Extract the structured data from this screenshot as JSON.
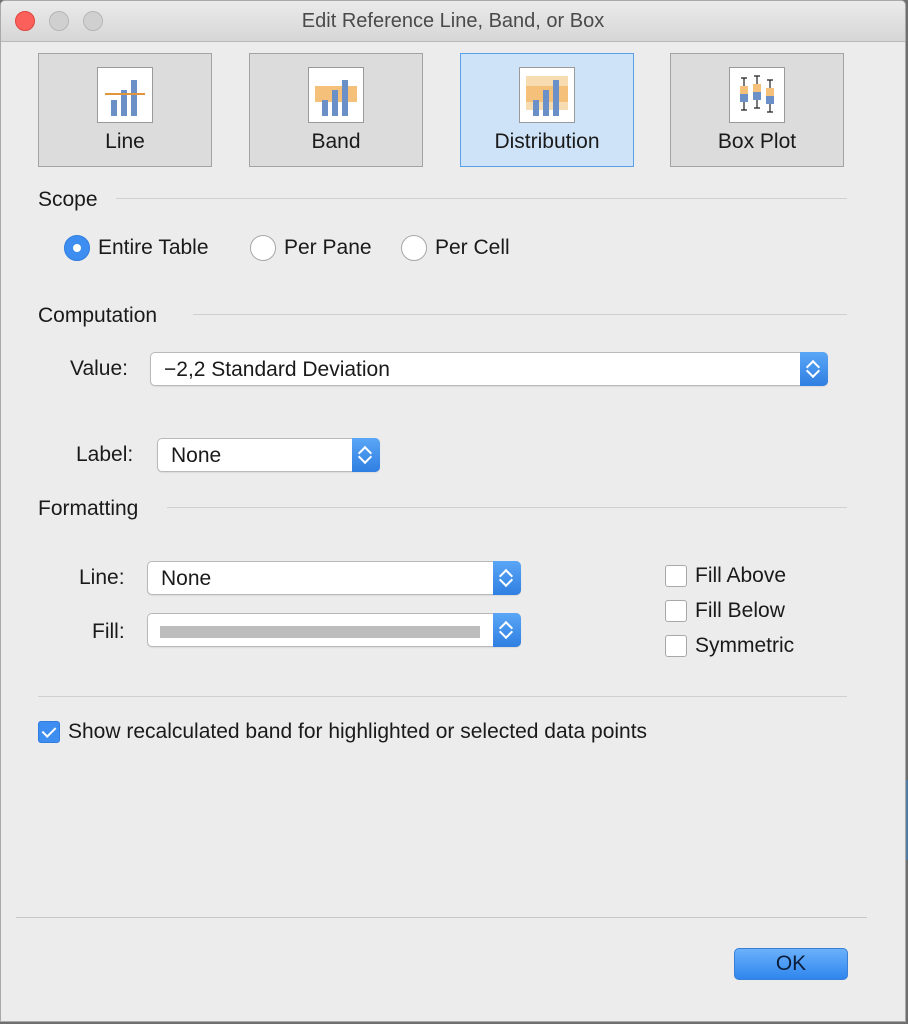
{
  "window": {
    "title": "Edit Reference Line, Band, or Box"
  },
  "tabs": [
    {
      "label": "Line",
      "icon": "reference-line-icon",
      "selected": false
    },
    {
      "label": "Band",
      "icon": "reference-band-icon",
      "selected": false
    },
    {
      "label": "Distribution",
      "icon": "distribution-icon",
      "selected": true
    },
    {
      "label": "Box Plot",
      "icon": "box-plot-icon",
      "selected": false
    }
  ],
  "scope": {
    "heading": "Scope",
    "options": [
      {
        "label": "Entire Table",
        "selected": true
      },
      {
        "label": "Per Pane",
        "selected": false
      },
      {
        "label": "Per Cell",
        "selected": false
      }
    ]
  },
  "computation": {
    "heading": "Computation",
    "value_label": "Value:",
    "value": "−2,2 Standard Deviation",
    "label_label": "Label:",
    "label_value": "None"
  },
  "formatting": {
    "heading": "Formatting",
    "line_label": "Line:",
    "line_value": "None",
    "fill_label": "Fill:",
    "fill_above": {
      "label": "Fill Above",
      "checked": false
    },
    "fill_below": {
      "label": "Fill Below",
      "checked": false
    },
    "symmetric": {
      "label": "Symmetric",
      "checked": false
    }
  },
  "show_recalculated": {
    "label": "Show recalculated band for highlighted or selected data points",
    "checked": true
  },
  "ok_label": "OK",
  "colors": {
    "accent": "#3d8ef0",
    "selected_tab_bg": "#cfe3f8",
    "icon_bar": "#6b8fc7",
    "icon_band": "#f4c07a"
  }
}
